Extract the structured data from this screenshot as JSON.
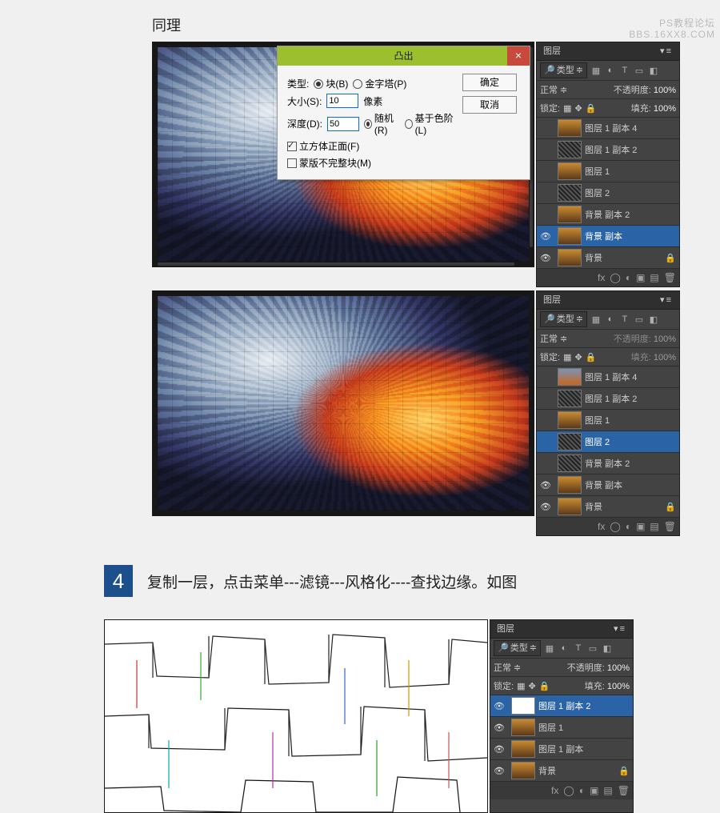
{
  "watermark": {
    "line1": "PS教程论坛",
    "line2": "BBS.16XX8.COM"
  },
  "heading1": "同理",
  "dialog": {
    "title": "凸出",
    "close": "×",
    "type_label": "类型:",
    "opt_block": "块(B)",
    "opt_pyramid": "金字塔(P)",
    "size_label": "大小(S):",
    "size_value": "10",
    "size_unit": "像素",
    "depth_label": "深度(D):",
    "depth_value": "50",
    "opt_random": "随机(R)",
    "opt_level": "基于色阶(L)",
    "chk_solid": "立方体正面(F)",
    "chk_mask": "蒙版不完整块(M)",
    "ok": "确定",
    "cancel": "取消"
  },
  "panel_common": {
    "tab": "图层",
    "kind_label": "类型",
    "blend_normal": "正常",
    "opacity_label": "不透明度:",
    "fill_label": "填充:",
    "lock_label": "锁定:",
    "p100": "100%"
  },
  "panel1": {
    "layers": [
      {
        "vis": false,
        "thumb": "sun",
        "name": "图层 1 副本 4"
      },
      {
        "vis": false,
        "thumb": "noise",
        "name": "图层 1 副本 2"
      },
      {
        "vis": false,
        "thumb": "sun",
        "name": "图层 1"
      },
      {
        "vis": false,
        "thumb": "noise",
        "name": "图层 2"
      },
      {
        "vis": false,
        "thumb": "sun",
        "name": "背景 副本 2"
      },
      {
        "vis": true,
        "thumb": "sun",
        "name": "背景 副本",
        "sel": true
      },
      {
        "vis": true,
        "thumb": "sun",
        "name": "背景",
        "lock": true
      }
    ]
  },
  "panel2": {
    "layers": [
      {
        "vis": false,
        "thumb": "sky",
        "name": "图层 1 副本 4"
      },
      {
        "vis": false,
        "thumb": "noise",
        "name": "图层 1 副本 2"
      },
      {
        "vis": false,
        "thumb": "sun",
        "name": "图层 1"
      },
      {
        "vis": false,
        "thumb": "noise",
        "name": "图层 2",
        "sel": true
      },
      {
        "vis": false,
        "thumb": "noise",
        "name": "背景 副本 2"
      },
      {
        "vis": true,
        "thumb": "sun",
        "name": "背景 副本"
      },
      {
        "vis": true,
        "thumb": "sun",
        "name": "背景",
        "lock": true
      }
    ]
  },
  "step4": {
    "num": "4",
    "text": "复制一层，点击菜单---滤镜---风格化----查找边缘。如图"
  },
  "panel3": {
    "layers": [
      {
        "vis": true,
        "thumb": "edge",
        "name": "图层 1 副本 2",
        "sel": true
      },
      {
        "vis": true,
        "thumb": "sun",
        "name": "图层 1"
      },
      {
        "vis": true,
        "thumb": "sun",
        "name": "图层 1 副本"
      },
      {
        "vis": true,
        "thumb": "sun",
        "name": "背景",
        "lock": true
      }
    ]
  }
}
